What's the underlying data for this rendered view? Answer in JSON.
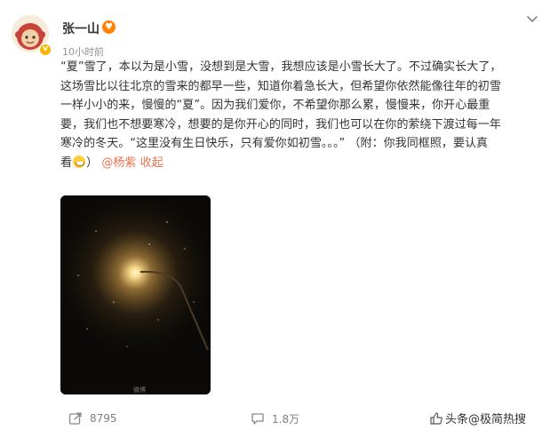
{
  "post": {
    "author": "张一山",
    "time": "10小时前",
    "text_lines": [
      "“夏”雪了，本以为是小雪，没想到是大雪，我想应该是小雪长大了。不过确实长大了，",
      "这场雪比以往北京的雪来的都早一些，知道你着急长大，但希望你依然能像往年的初雪",
      "一样小小的来，慢慢的“夏”。因为我们爱你，不希望你那么累，慢慢来，你开心最重",
      "要，我们也不想要寒冷，想要的是你开心的同时，我们也可以在你的萦绕下渡过每一年",
      "寒冷的冬天。“这里没有生日快乐，只有爱你如初雪。。。” （附：你我同框照，要认真"
    ],
    "last_line_prefix": "看",
    "last_line_suffix": "）",
    "mention": "@杨紫",
    "collapse_label": "收起",
    "photo_watermark": "微博"
  },
  "actions": {
    "repost_count": "8795",
    "comment_count": "1.8万"
  },
  "watermark": {
    "text": "头条@极简热搜"
  },
  "icons": {
    "avatar": "cartoon-avatar-icon",
    "verified": "verified-badge-icon",
    "user_badge": "heart-eyes-badge-icon",
    "menu": "chevron-down-icon",
    "repost": "repost-icon",
    "comment": "comment-icon",
    "like": "thumbs-up-icon"
  },
  "colors": {
    "link": "#eb7350",
    "verified": "#f7b500",
    "muted": "#939393"
  }
}
